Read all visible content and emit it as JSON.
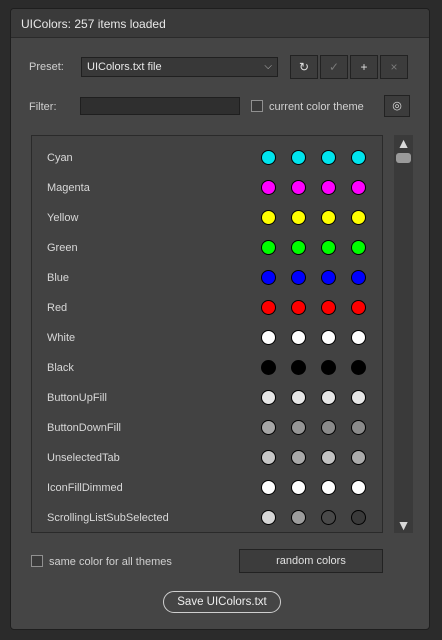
{
  "window": {
    "title": "UIColors: 257 items loaded"
  },
  "preset": {
    "label": "Preset:",
    "selected": "UIColors.txt file",
    "buttons": [
      {
        "icon": "refresh-icon",
        "glyph": "↻",
        "enabled": true
      },
      {
        "icon": "check-icon",
        "glyph": "✓",
        "enabled": false
      },
      {
        "icon": "plus-icon",
        "glyph": "+",
        "enabled": true
      },
      {
        "icon": "close-icon",
        "glyph": "×",
        "enabled": false
      }
    ]
  },
  "filter": {
    "label": "Filter:",
    "value": "",
    "checkbox_label": "current color theme",
    "checked": false,
    "settings_icon": "target-icon"
  },
  "list": {
    "items": [
      {
        "name": "Cyan",
        "colors": [
          "#00e5ee",
          "#00e5ee",
          "#00e5ee",
          "#00e5ee"
        ]
      },
      {
        "name": "Magenta",
        "colors": [
          "#ff00ff",
          "#ff00ff",
          "#ff00ff",
          "#ff00ff"
        ]
      },
      {
        "name": "Yellow",
        "colors": [
          "#ffff00",
          "#ffff00",
          "#ffff00",
          "#ffff00"
        ]
      },
      {
        "name": "Green",
        "colors": [
          "#00ff00",
          "#00ff00",
          "#00ff00",
          "#00ff00"
        ]
      },
      {
        "name": "Blue",
        "colors": [
          "#0000ff",
          "#0000ff",
          "#0000ff",
          "#0000ff"
        ]
      },
      {
        "name": "Red",
        "colors": [
          "#ff0000",
          "#ff0000",
          "#ff0000",
          "#ff0000"
        ]
      },
      {
        "name": "White",
        "colors": [
          "#ffffff",
          "#ffffff",
          "#ffffff",
          "#ffffff"
        ]
      },
      {
        "name": "Black",
        "colors": [
          "#000000",
          "#000000",
          "#000000",
          "#000000"
        ]
      },
      {
        "name": "ButtonUpFill",
        "colors": [
          "#e6e6e6",
          "#e6e6e6",
          "#e6e6e6",
          "#e6e6e6"
        ]
      },
      {
        "name": "ButtonDownFill",
        "colors": [
          "#a6a6a6",
          "#959595",
          "#8a8a8a",
          "#8a8a8a"
        ]
      },
      {
        "name": "UnselectedTab",
        "colors": [
          "#c7c7c7",
          "#a9a9a9",
          "#c2c2c2",
          "#ababab"
        ]
      },
      {
        "name": "IconFillDimmed",
        "colors": [
          "#ffffff",
          "#ffffff",
          "#ffffff",
          "#ffffff"
        ]
      },
      {
        "name": "ScrollingListSubSelected",
        "colors": [
          "#d6d6d6",
          "#9d9d9d",
          "#494949",
          "#3a3a3a"
        ]
      }
    ]
  },
  "footer": {
    "same_color_label": "same color for all themes",
    "same_color_checked": false,
    "random_label": "random colors",
    "save_label": "Save UIColors.txt"
  }
}
